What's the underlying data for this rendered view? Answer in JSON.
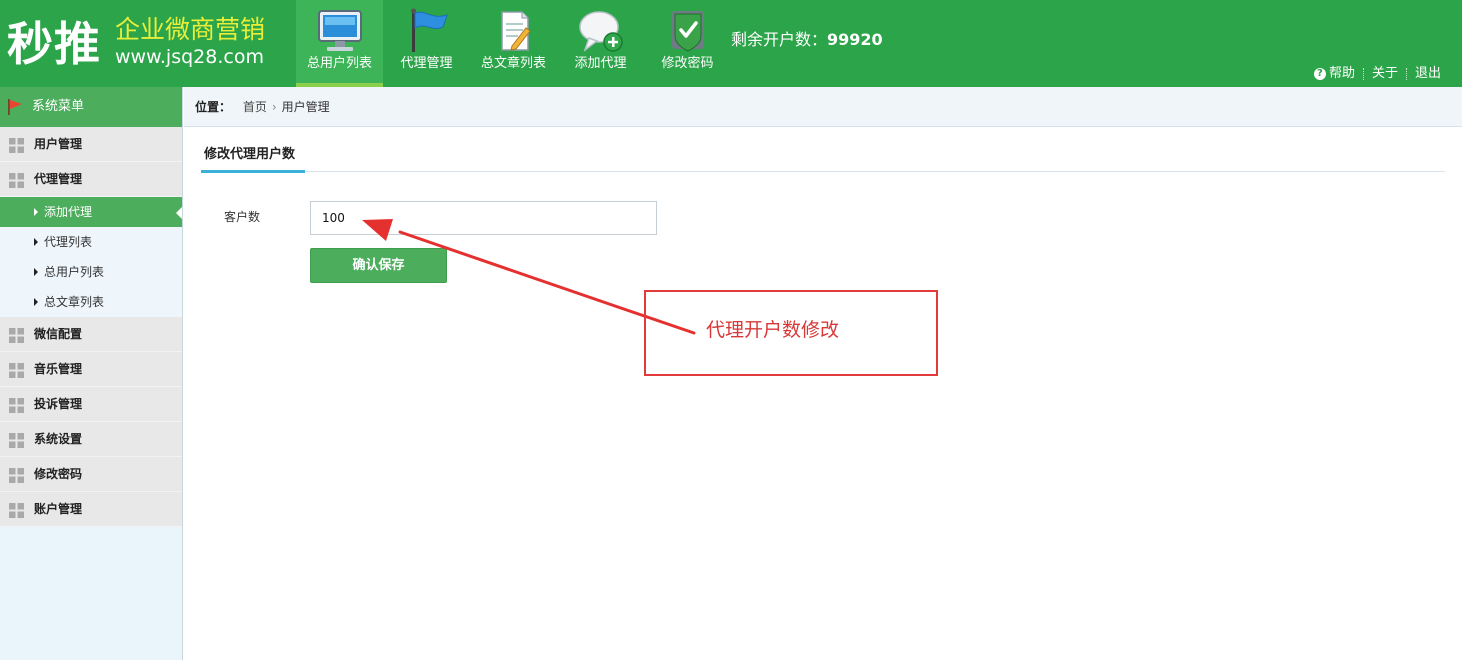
{
  "brand": {
    "name": "秒推",
    "slogan": "企业微商营销",
    "url": "www.jsq28.com"
  },
  "nav": [
    {
      "label": "总用户列表",
      "icon": "monitor-icon",
      "active": true
    },
    {
      "label": "代理管理",
      "icon": "flag-icon",
      "active": false
    },
    {
      "label": "总文章列表",
      "icon": "document-edit-icon",
      "active": false
    },
    {
      "label": "添加代理",
      "icon": "chat-add-icon",
      "active": false
    },
    {
      "label": "修改密码",
      "icon": "shield-check-icon",
      "active": false
    }
  ],
  "remaining": {
    "label": "剩余开户数：",
    "value": "99920"
  },
  "toplinks": {
    "help_icon": "?",
    "help": "帮助",
    "about": "关于",
    "logout": "退出"
  },
  "sidebar": {
    "title": "系统菜单",
    "groups": [
      {
        "label": "用户管理"
      },
      {
        "label": "代理管理",
        "children": [
          "添加代理",
          "代理列表",
          "总用户列表",
          "总文章列表"
        ]
      },
      {
        "label": "微信配置"
      },
      {
        "label": "音乐管理"
      },
      {
        "label": "投诉管理"
      },
      {
        "label": "系统设置"
      },
      {
        "label": "修改密码"
      },
      {
        "label": "账户管理"
      }
    ],
    "active_child": "添加代理"
  },
  "breadcrumb": {
    "label": "位置：",
    "items": [
      "首页",
      "用户管理"
    ],
    "separator": "›"
  },
  "tab": {
    "label": "修改代理用户数"
  },
  "form": {
    "field_label": "客户数",
    "field_value": "100",
    "save_label": "确认保存"
  },
  "annotation": {
    "text": "代理开户数修改",
    "color": "#e03a3a"
  },
  "colors": {
    "header_green": "#2ca44a",
    "menu_green": "#4cae5c",
    "slogan_yellow": "#e8ee3a",
    "tab_underline": "#3bb0d9"
  }
}
